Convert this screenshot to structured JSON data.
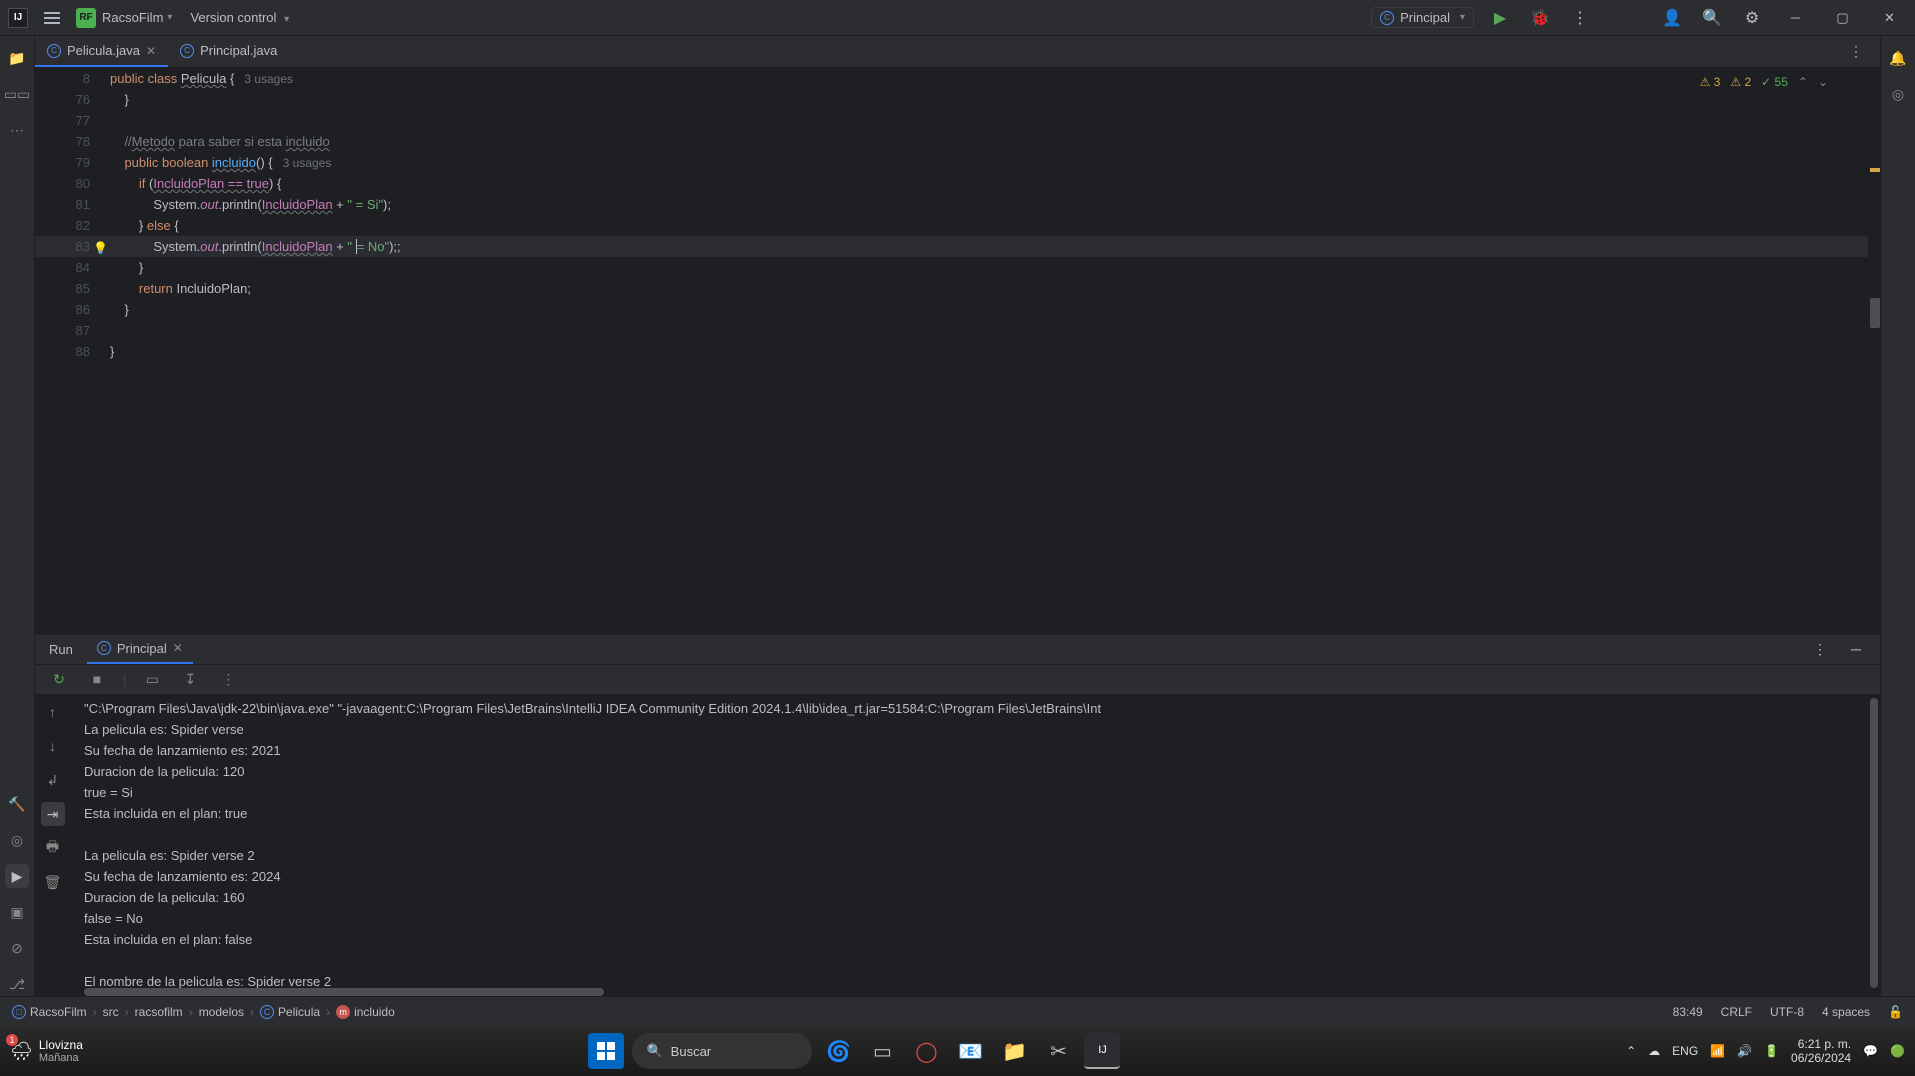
{
  "title_bar": {
    "project_badge": "RF",
    "project_name": "RacsoFilm",
    "vcs_label": "Version control",
    "run_config": "Principal"
  },
  "tabs": [
    {
      "name": "Pelicula.java",
      "active": true
    },
    {
      "name": "Principal.java",
      "active": false
    }
  ],
  "inspections": {
    "warn1": "3",
    "warn2": "2",
    "checks": "55"
  },
  "code": {
    "lines": [
      {
        "num": "8",
        "segments": [
          {
            "t": "public ",
            "c": "kw"
          },
          {
            "t": "class ",
            "c": "kw"
          },
          {
            "t": "Pelicula",
            "c": "ident underline"
          },
          {
            "t": " {",
            "c": "ident"
          },
          {
            "t": "   3 usages",
            "c": "hint"
          }
        ]
      },
      {
        "num": "76",
        "segments": [
          {
            "t": "    }",
            "c": "ident"
          }
        ]
      },
      {
        "num": "77",
        "segments": []
      },
      {
        "num": "78",
        "segments": [
          {
            "t": "    //",
            "c": "comment"
          },
          {
            "t": "Metodo",
            "c": "comment underline"
          },
          {
            "t": " para saber si esta ",
            "c": "comment"
          },
          {
            "t": "incluido",
            "c": "comment underline"
          }
        ]
      },
      {
        "num": "79",
        "segments": [
          {
            "t": "    public ",
            "c": "kw"
          },
          {
            "t": "boolean ",
            "c": "kw"
          },
          {
            "t": "incluido",
            "c": "method underline"
          },
          {
            "t": "() {",
            "c": "ident"
          },
          {
            "t": "   3 usages",
            "c": "hint"
          }
        ]
      },
      {
        "num": "80",
        "segments": [
          {
            "t": "        if ",
            "c": "kw"
          },
          {
            "t": "(",
            "c": "ident"
          },
          {
            "t": "IncluidoPlan == true",
            "c": "field underline"
          },
          {
            "t": ") {",
            "c": "ident"
          }
        ]
      },
      {
        "num": "81",
        "segments": [
          {
            "t": "            System.",
            "c": "ident"
          },
          {
            "t": "out",
            "c": "field italic"
          },
          {
            "t": ".println(",
            "c": "ident"
          },
          {
            "t": "IncluidoPlan",
            "c": "field underline"
          },
          {
            "t": " + ",
            "c": "ident"
          },
          {
            "t": "\" = Si\"",
            "c": "str"
          },
          {
            "t": ");",
            "c": "ident"
          }
        ]
      },
      {
        "num": "82",
        "segments": [
          {
            "t": "        } ",
            "c": "ident"
          },
          {
            "t": "else ",
            "c": "kw"
          },
          {
            "t": "{",
            "c": "ident"
          }
        ]
      },
      {
        "num": "83",
        "current": true,
        "bulb": true,
        "segments": [
          {
            "t": "            System.",
            "c": "ident"
          },
          {
            "t": "out",
            "c": "field italic"
          },
          {
            "t": ".println(",
            "c": "ident"
          },
          {
            "t": "IncluidoPlan",
            "c": "field underline"
          },
          {
            "t": " + ",
            "c": "ident"
          },
          {
            "t": "\" ",
            "c": "str"
          },
          {
            "t": "",
            "c": "caret"
          },
          {
            "t": "= No\"",
            "c": "str"
          },
          {
            "t": ");;",
            "c": "ident"
          }
        ]
      },
      {
        "num": "84",
        "segments": [
          {
            "t": "        }",
            "c": "ident"
          }
        ]
      },
      {
        "num": "85",
        "segments": [
          {
            "t": "        return ",
            "c": "kw"
          },
          {
            "t": "IncluidoPlan;",
            "c": "ident"
          }
        ]
      },
      {
        "num": "86",
        "segments": [
          {
            "t": "    }",
            "c": "ident"
          }
        ]
      },
      {
        "num": "87",
        "segments": []
      },
      {
        "num": "88",
        "segments": [
          {
            "t": "}",
            "c": "ident"
          }
        ]
      }
    ]
  },
  "run": {
    "label": "Run",
    "tab": "Principal",
    "console_lines": [
      "\"C:\\Program Files\\Java\\jdk-22\\bin\\java.exe\" \"-javaagent:C:\\Program Files\\JetBrains\\IntelliJ IDEA Community Edition 2024.1.4\\lib\\idea_rt.jar=51584:C:\\Program Files\\JetBrains\\Int",
      "La pelicula es: Spider verse",
      "Su fecha de lanzamiento es: 2021",
      "Duracion de la pelicula: 120",
      "true = Si",
      "Esta incluida en el plan: true",
      "",
      "La pelicula es: Spider verse 2",
      "Su fecha de lanzamiento es: 2024",
      "Duracion de la pelicula: 160",
      "false = No",
      "Esta incluida en el plan: false",
      "",
      "El nombre de la pelicula es: Spider verse 2"
    ]
  },
  "breadcrumbs": [
    {
      "label": "RacsoFilm",
      "icon": "pkg"
    },
    {
      "label": "src"
    },
    {
      "label": "racsofilm"
    },
    {
      "label": "modelos"
    },
    {
      "label": "Pelicula",
      "icon": "cls"
    },
    {
      "label": "incluido",
      "icon": "mth"
    }
  ],
  "status": {
    "position": "83:49",
    "line_ending": "CRLF",
    "encoding": "UTF-8",
    "indent": "4 spaces"
  },
  "taskbar": {
    "weather_main": "Llovizna",
    "weather_sub": "Mañana",
    "search_placeholder": "Buscar",
    "lang": "ENG",
    "time": "6:21 p. m.",
    "date": "06/26/2024"
  }
}
